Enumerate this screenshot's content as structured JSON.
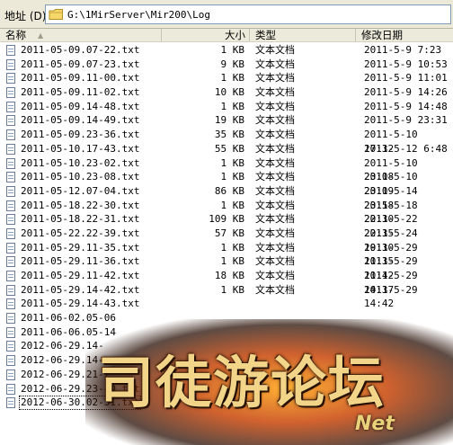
{
  "address_bar": {
    "label": "地址 (D)",
    "path": "G:\\1MirServer\\Mir200\\Log"
  },
  "columns": {
    "name": "名称",
    "size": "大小",
    "type": "类型",
    "modified": "修改日期"
  },
  "files": [
    {
      "name": "2011-05-09.07-22.txt",
      "size": "1 KB",
      "type": "文本文档",
      "modified": "2011-5-9  7:23"
    },
    {
      "name": "2011-05-09.07-23.txt",
      "size": "9 KB",
      "type": "文本文档",
      "modified": "2011-5-9 10:53"
    },
    {
      "name": "2011-05-09.11-00.txt",
      "size": "1 KB",
      "type": "文本文档",
      "modified": "2011-5-9 11:01"
    },
    {
      "name": "2011-05-09.11-02.txt",
      "size": "10 KB",
      "type": "文本文档",
      "modified": "2011-5-9 14:26"
    },
    {
      "name": "2011-05-09.14-48.txt",
      "size": "1 KB",
      "type": "文本文档",
      "modified": "2011-5-9 14:48"
    },
    {
      "name": "2011-05-09.14-49.txt",
      "size": "19 KB",
      "type": "文本文档",
      "modified": "2011-5-9 23:31"
    },
    {
      "name": "2011-05-09.23-36.txt",
      "size": "35 KB",
      "type": "文本文档",
      "modified": "2011-5-10 17:32"
    },
    {
      "name": "2011-05-10.17-43.txt",
      "size": "55 KB",
      "type": "文本文档",
      "modified": "2011-5-12 6:48"
    },
    {
      "name": "2011-05-10.23-02.txt",
      "size": "1 KB",
      "type": "文本文档",
      "modified": "2011-5-10 23:08"
    },
    {
      "name": "2011-05-10.23-08.txt",
      "size": "1 KB",
      "type": "文本文档",
      "modified": "2011-5-10 23:09"
    },
    {
      "name": "2011-05-12.07-04.txt",
      "size": "86 KB",
      "type": "文本文档",
      "modified": "2011-5-14 23:58"
    },
    {
      "name": "2011-05-18.22-30.txt",
      "size": "1 KB",
      "type": "文本文档",
      "modified": "2011-5-18 22:30"
    },
    {
      "name": "2011-05-18.22-31.txt",
      "size": "109 KB",
      "type": "文本文档",
      "modified": "2011-5-22 22:35"
    },
    {
      "name": "2011-05-22.22-39.txt",
      "size": "57 KB",
      "type": "文本文档",
      "modified": "2011-5-24 19:30"
    },
    {
      "name": "2011-05-29.11-35.txt",
      "size": "1 KB",
      "type": "文本文档",
      "modified": "2011-5-29 11:35"
    },
    {
      "name": "2011-05-29.11-36.txt",
      "size": "1 KB",
      "type": "文本文档",
      "modified": "2011-5-29 11:42"
    },
    {
      "name": "2011-05-29.11-42.txt",
      "size": "18 KB",
      "type": "文本文档",
      "modified": "2011-5-29 14:37"
    },
    {
      "name": "2011-05-29.14-42.txt",
      "size": "1 KB",
      "type": "文本文档",
      "modified": "2011-5-29 14:42"
    },
    {
      "name": "2011-05-29.14-43.txt",
      "size": "",
      "type": "",
      "modified": ""
    },
    {
      "name": "2011-06-02.05-06",
      "size": "",
      "type": "",
      "modified": ""
    },
    {
      "name": "2011-06-06.05-14",
      "size": "",
      "type": "",
      "modified": ""
    },
    {
      "name": "2012-06-29.14-",
      "size": "",
      "type": "",
      "modified": ""
    },
    {
      "name": "2012-06-29.14-",
      "size": "",
      "type": "",
      "modified": ""
    },
    {
      "name": "2012-06-29.21-2",
      "size": "",
      "type": "",
      "modified": ""
    },
    {
      "name": "2012-06-29.23-40.txt",
      "size": "",
      "type": "",
      "modified": ""
    },
    {
      "name": "2012-06-30.02-31.txt",
      "size": "",
      "type": "",
      "modified": ""
    }
  ],
  "selected_index": 25,
  "watermark": {
    "main": "司徒游论坛",
    "sub": "Net"
  },
  "colors": {
    "chrome": "#ece9d8",
    "header": "#ebeadb",
    "address_border": "#7f9db9"
  }
}
